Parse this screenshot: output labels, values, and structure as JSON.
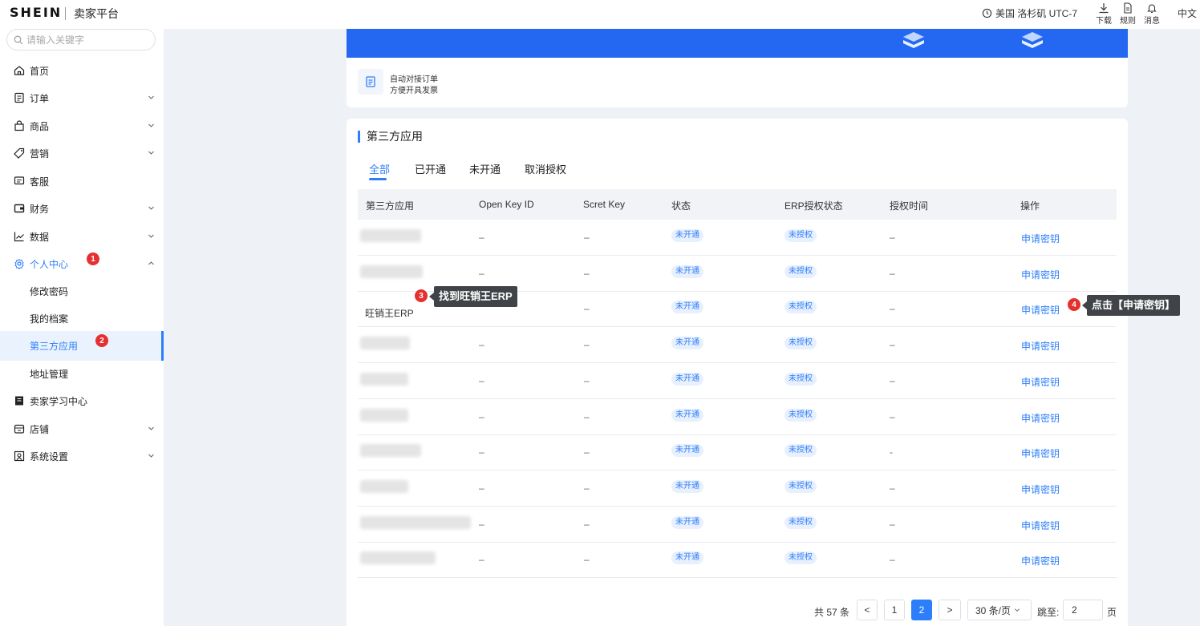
{
  "header": {
    "brand": "SHEIN",
    "platform": "卖家平台",
    "timezone": "美国 洛杉矶 UTC-7",
    "tools": [
      {
        "label": "下载",
        "icon": "download-icon"
      },
      {
        "label": "规则",
        "icon": "document-icon"
      },
      {
        "label": "消息",
        "icon": "bell-icon"
      }
    ],
    "language": "中文"
  },
  "sidebar": {
    "search_placeholder": "请输入关键字",
    "items": [
      {
        "label": "首页",
        "icon": "home-icon"
      },
      {
        "label": "订单",
        "icon": "order-icon"
      },
      {
        "label": "商品",
        "icon": "bag-icon"
      },
      {
        "label": "营销",
        "icon": "tag-icon"
      },
      {
        "label": "客服",
        "icon": "chat-icon"
      },
      {
        "label": "财务",
        "icon": "wallet-icon"
      },
      {
        "label": "数据",
        "icon": "chart-icon"
      },
      {
        "label": "个人中心",
        "icon": "gear-icon"
      },
      {
        "label": "卖家学习中心",
        "icon": "book-icon"
      },
      {
        "label": "店铺",
        "icon": "store-icon"
      },
      {
        "label": "系统设置",
        "icon": "settings-icon"
      }
    ],
    "sub_items": [
      {
        "label": "修改密码"
      },
      {
        "label": "我的档案"
      },
      {
        "label": "第三方应用"
      },
      {
        "label": "地址管理"
      }
    ]
  },
  "feature": {
    "line1": "自动对接订单",
    "line2": "方便开具发票"
  },
  "section": {
    "title": "第三方应用",
    "tabs": [
      "全部",
      "已开通",
      "未开通",
      "取消授权"
    ]
  },
  "table": {
    "columns": [
      "第三方应用",
      "Open Key ID",
      "Scret Key",
      "状态",
      "ERP授权状态",
      "授权时间",
      "操作"
    ],
    "rows": [
      {
        "app": "",
        "key_id": "–",
        "secret": "–",
        "status": "未开通",
        "erp": "未授权",
        "time": "–",
        "action": "申请密钥"
      },
      {
        "app": "",
        "key_id": "–",
        "secret": "–",
        "status": "未开通",
        "erp": "未授权",
        "time": "–",
        "action": "申请密钥"
      },
      {
        "app": "旺销王ERP",
        "key_id": "",
        "secret": "–",
        "status": "未开通",
        "erp": "未授权",
        "time": "–",
        "action": "申请密钥"
      },
      {
        "app": "",
        "key_id": "–",
        "secret": "–",
        "status": "未开通",
        "erp": "未授权",
        "time": "–",
        "action": "申请密钥"
      },
      {
        "app": "",
        "key_id": "–",
        "secret": "–",
        "status": "未开通",
        "erp": "未授权",
        "time": "–",
        "action": "申请密钥"
      },
      {
        "app": "",
        "key_id": "–",
        "secret": "–",
        "status": "未开通",
        "erp": "未授权",
        "time": "–",
        "action": "申请密钥"
      },
      {
        "app": "",
        "key_id": "–",
        "secret": "–",
        "status": "未开通",
        "erp": "未授权",
        "time": "-",
        "action": "申请密钥"
      },
      {
        "app": "",
        "key_id": "–",
        "secret": "–",
        "status": "未开通",
        "erp": "未授权",
        "time": "–",
        "action": "申请密钥"
      },
      {
        "app": "",
        "key_id": "–",
        "secret": "–",
        "status": "未开通",
        "erp": "未授权",
        "time": "–",
        "action": "申请密钥"
      },
      {
        "app": "",
        "key_id": "–",
        "secret": "–",
        "status": "未开通",
        "erp": "未授权",
        "time": "–",
        "action": "申请密钥"
      }
    ]
  },
  "annotations": {
    "badge1": "1",
    "badge2": "2",
    "badge3": "3",
    "badge4": "4",
    "callout3": "找到旺销王ERP",
    "callout4": "点击【申请密钥】"
  },
  "pagination": {
    "total": "共 57 条",
    "prev": "<",
    "pages": [
      "1",
      "2"
    ],
    "current": "2",
    "next": ">",
    "page_size": "30 条/页",
    "jump_label": "跳至:",
    "jump_value": "2",
    "page_unit": "页"
  }
}
